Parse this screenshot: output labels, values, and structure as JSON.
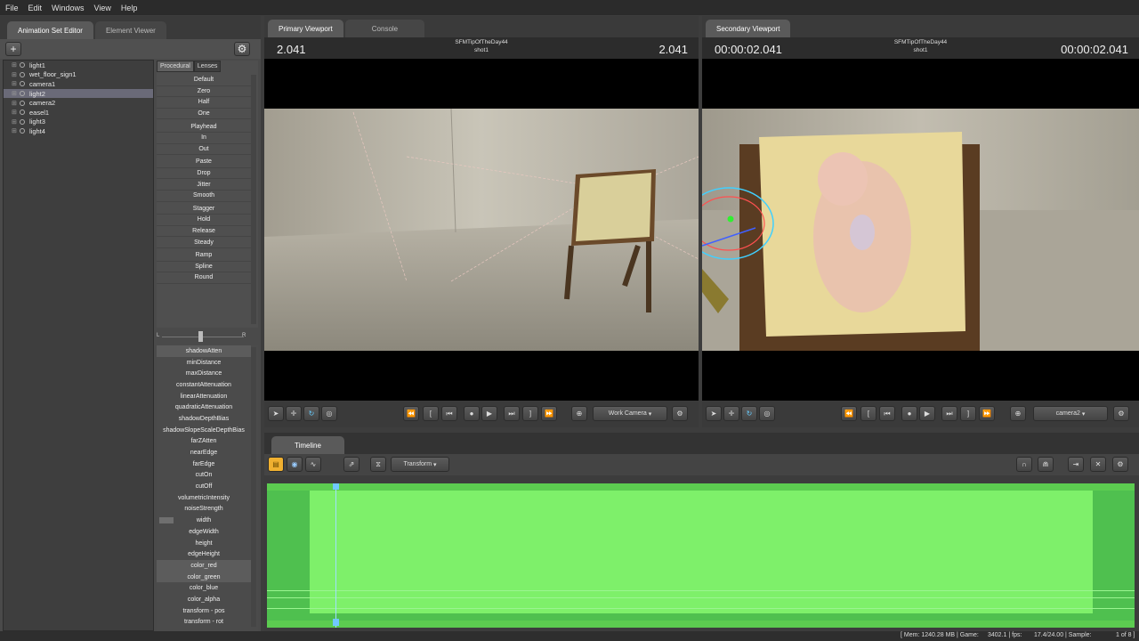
{
  "menu": [
    "File",
    "Edit",
    "Windows",
    "View",
    "Help"
  ],
  "left": {
    "tabs": [
      "Animation Set Editor",
      "Element Viewer"
    ],
    "add_label": "+",
    "tree": [
      {
        "label": "light1",
        "selected": false
      },
      {
        "label": "wet_floor_sign1",
        "selected": false
      },
      {
        "label": "camera1",
        "selected": false
      },
      {
        "label": "light2",
        "selected": true
      },
      {
        "label": "camera2",
        "selected": false
      },
      {
        "label": "easel1",
        "selected": false
      },
      {
        "label": "light3",
        "selected": false
      },
      {
        "label": "light4",
        "selected": false
      }
    ],
    "preset_tabs": [
      "Procedural",
      "Lenses"
    ],
    "presets": [
      [
        "Default",
        "Zero",
        "Half",
        "One"
      ],
      [
        "Playhead",
        "In",
        "Out"
      ],
      [
        "Paste",
        "Drop",
        "Jitter",
        "Smooth"
      ],
      [
        "Stagger",
        "Hold",
        "Release",
        "Steady"
      ],
      [
        "Ramp",
        "Spline",
        "Round"
      ]
    ],
    "slider": {
      "left_label": "L",
      "right_label": "R"
    },
    "attributes": [
      {
        "label": "shadowAtten",
        "hl": true,
        "level": 0
      },
      {
        "label": "minDistance",
        "hl": false,
        "level": 0
      },
      {
        "label": "maxDistance",
        "hl": false,
        "level": 0
      },
      {
        "label": "constantAttenuation",
        "hl": false,
        "level": 0
      },
      {
        "label": "linearAttenuation",
        "hl": false,
        "level": 0
      },
      {
        "label": "quadraticAttenuation",
        "hl": false,
        "level": 0
      },
      {
        "label": "shadowDepthBias",
        "hl": false,
        "level": 0
      },
      {
        "label": "shadowSlopeScaleDepthBias",
        "hl": false,
        "level": 0
      },
      {
        "label": "farZAtten",
        "hl": false,
        "level": 0
      },
      {
        "label": "nearEdge",
        "hl": false,
        "level": 0
      },
      {
        "label": "farEdge",
        "hl": false,
        "level": 0
      },
      {
        "label": "cutOn",
        "hl": false,
        "level": 0
      },
      {
        "label": "cutOff",
        "hl": false,
        "level": 0
      },
      {
        "label": "volumetricIntensity",
        "hl": false,
        "level": 0
      },
      {
        "label": "noiseStrength",
        "hl": false,
        "level": 0
      },
      {
        "label": "width",
        "hl": false,
        "level": 0.15
      },
      {
        "label": "edgeWidth",
        "hl": false,
        "level": 0
      },
      {
        "label": "height",
        "hl": false,
        "level": 0
      },
      {
        "label": "edgeHeight",
        "hl": false,
        "level": 0
      },
      {
        "label": "color_red",
        "hl": true,
        "level": 0
      },
      {
        "label": "color_green",
        "hl": true,
        "level": 0
      },
      {
        "label": "color_blue",
        "hl": false,
        "level": 0
      },
      {
        "label": "color_alpha",
        "hl": false,
        "level": 0
      },
      {
        "label": "transform - pos",
        "hl": false,
        "level": 0
      },
      {
        "label": "transform - rot",
        "hl": false,
        "level": 0
      }
    ]
  },
  "primary": {
    "tabs": [
      "Primary Viewport",
      "Console"
    ],
    "time_left": "2.041",
    "time_right": "2.041",
    "session": "SFMTipOfTheDay44",
    "shot": "shot1",
    "camera_label": "Work Camera"
  },
  "secondary": {
    "tabs": [
      "Secondary Viewport"
    ],
    "time_left": "00:00:02.041",
    "time_right": "00:00:02.041",
    "session": "SFMTipOfTheDay44",
    "shot": "shot1",
    "camera_label": "camera2"
  },
  "timeline": {
    "tab": "Timeline",
    "mode_label": "Transform"
  },
  "status": {
    "mem": "[ Mem: 1240.28 MB | Game:",
    "game": "3402.1 | fps:",
    "fps": "17.4/24.00 | Sample:",
    "page": "1 of 8 ]"
  },
  "colors": {
    "timeline_green": "#7ef06a",
    "timeline_dark": "#4fc04f",
    "accent_orange": "#f0b030",
    "selection": "#6a6a78"
  }
}
